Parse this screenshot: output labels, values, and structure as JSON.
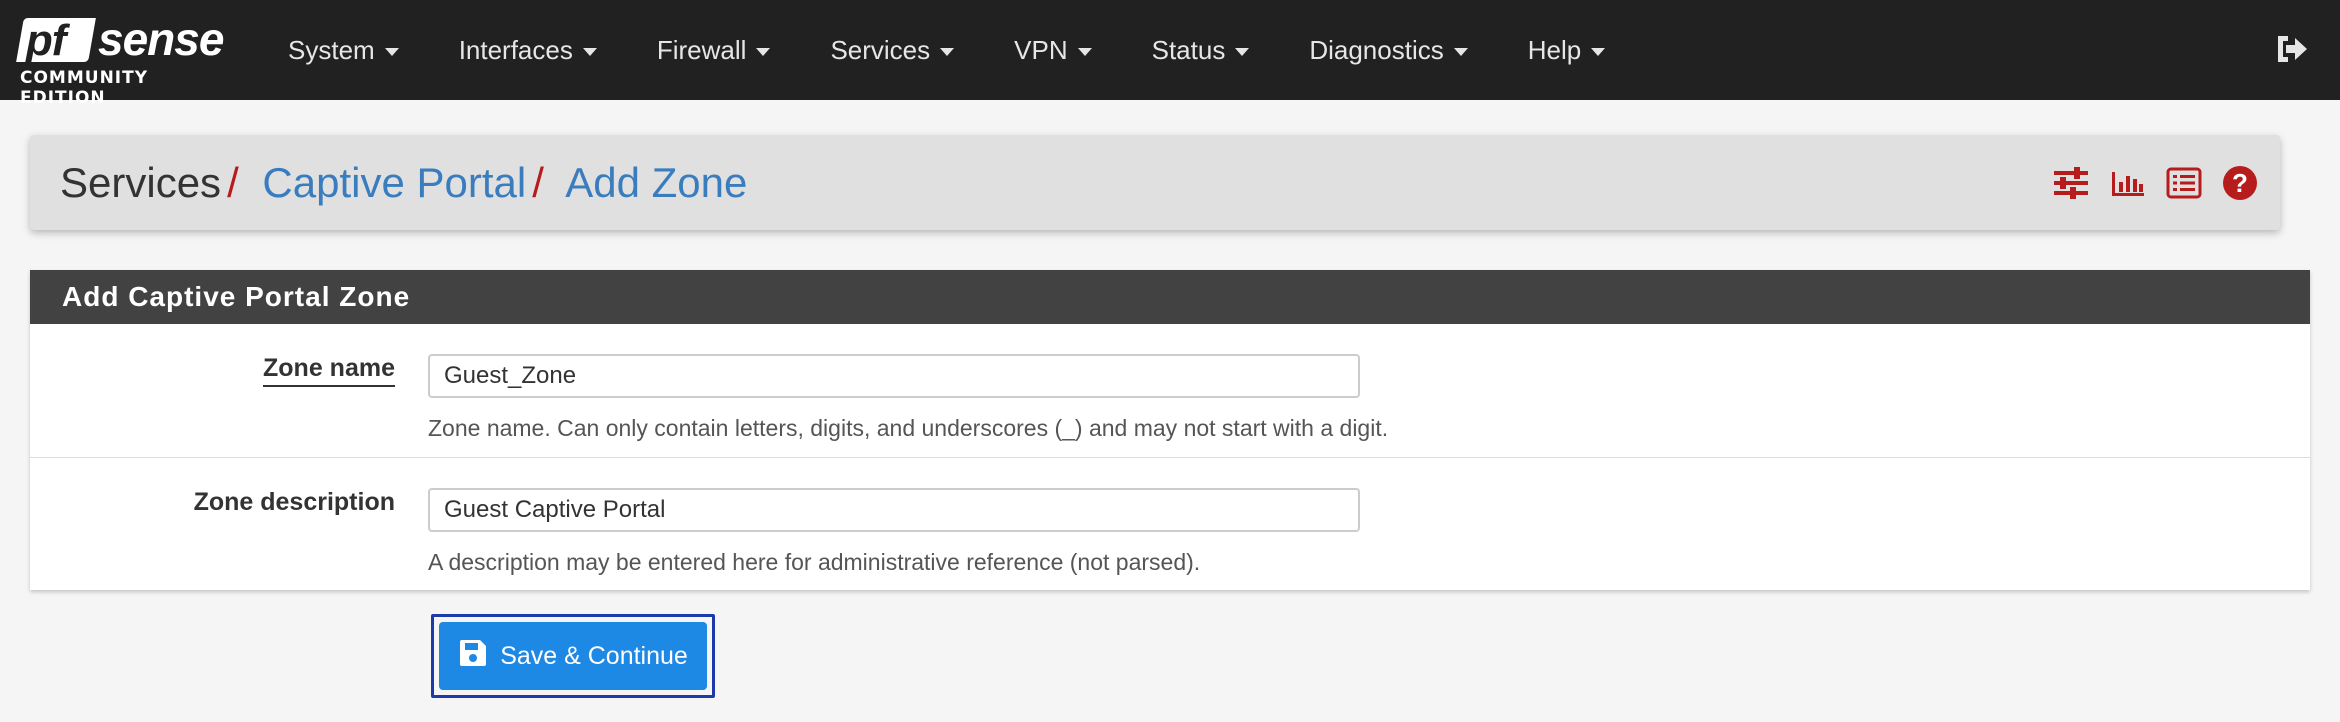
{
  "logo": {
    "brand_pf": "pf",
    "brand_sense": "sense",
    "edition": "COMMUNITY EDITION"
  },
  "nav": {
    "items": [
      {
        "label": "System"
      },
      {
        "label": "Interfaces"
      },
      {
        "label": "Firewall"
      },
      {
        "label": "Services"
      },
      {
        "label": "VPN"
      },
      {
        "label": "Status"
      },
      {
        "label": "Diagnostics"
      },
      {
        "label": "Help"
      }
    ],
    "logout_icon": "sign-out-icon"
  },
  "breadcrumb": {
    "items": [
      "Services",
      "Captive Portal",
      "Add Zone"
    ],
    "separator": "/",
    "icons": [
      "sliders-icon",
      "bar-chart-icon",
      "list-icon",
      "help-icon"
    ]
  },
  "panel": {
    "title": "Add Captive Portal Zone",
    "fields": [
      {
        "label": "Zone name",
        "value": "Guest_Zone",
        "help": "Zone name. Can only contain letters, digits, and underscores (_) and may not start with a digit."
      },
      {
        "label": "Zone description",
        "value": "Guest Captive Portal",
        "help": "A description may be entered here for administrative reference (not parsed)."
      }
    ]
  },
  "actions": {
    "save_label": "Save & Continue",
    "save_icon": "save-icon"
  },
  "colors": {
    "navbar": "#212121",
    "accent_red": "#b71c1c",
    "link_blue": "#3a7dbf",
    "panel_head": "#424242",
    "button_blue": "#1e88e5"
  }
}
